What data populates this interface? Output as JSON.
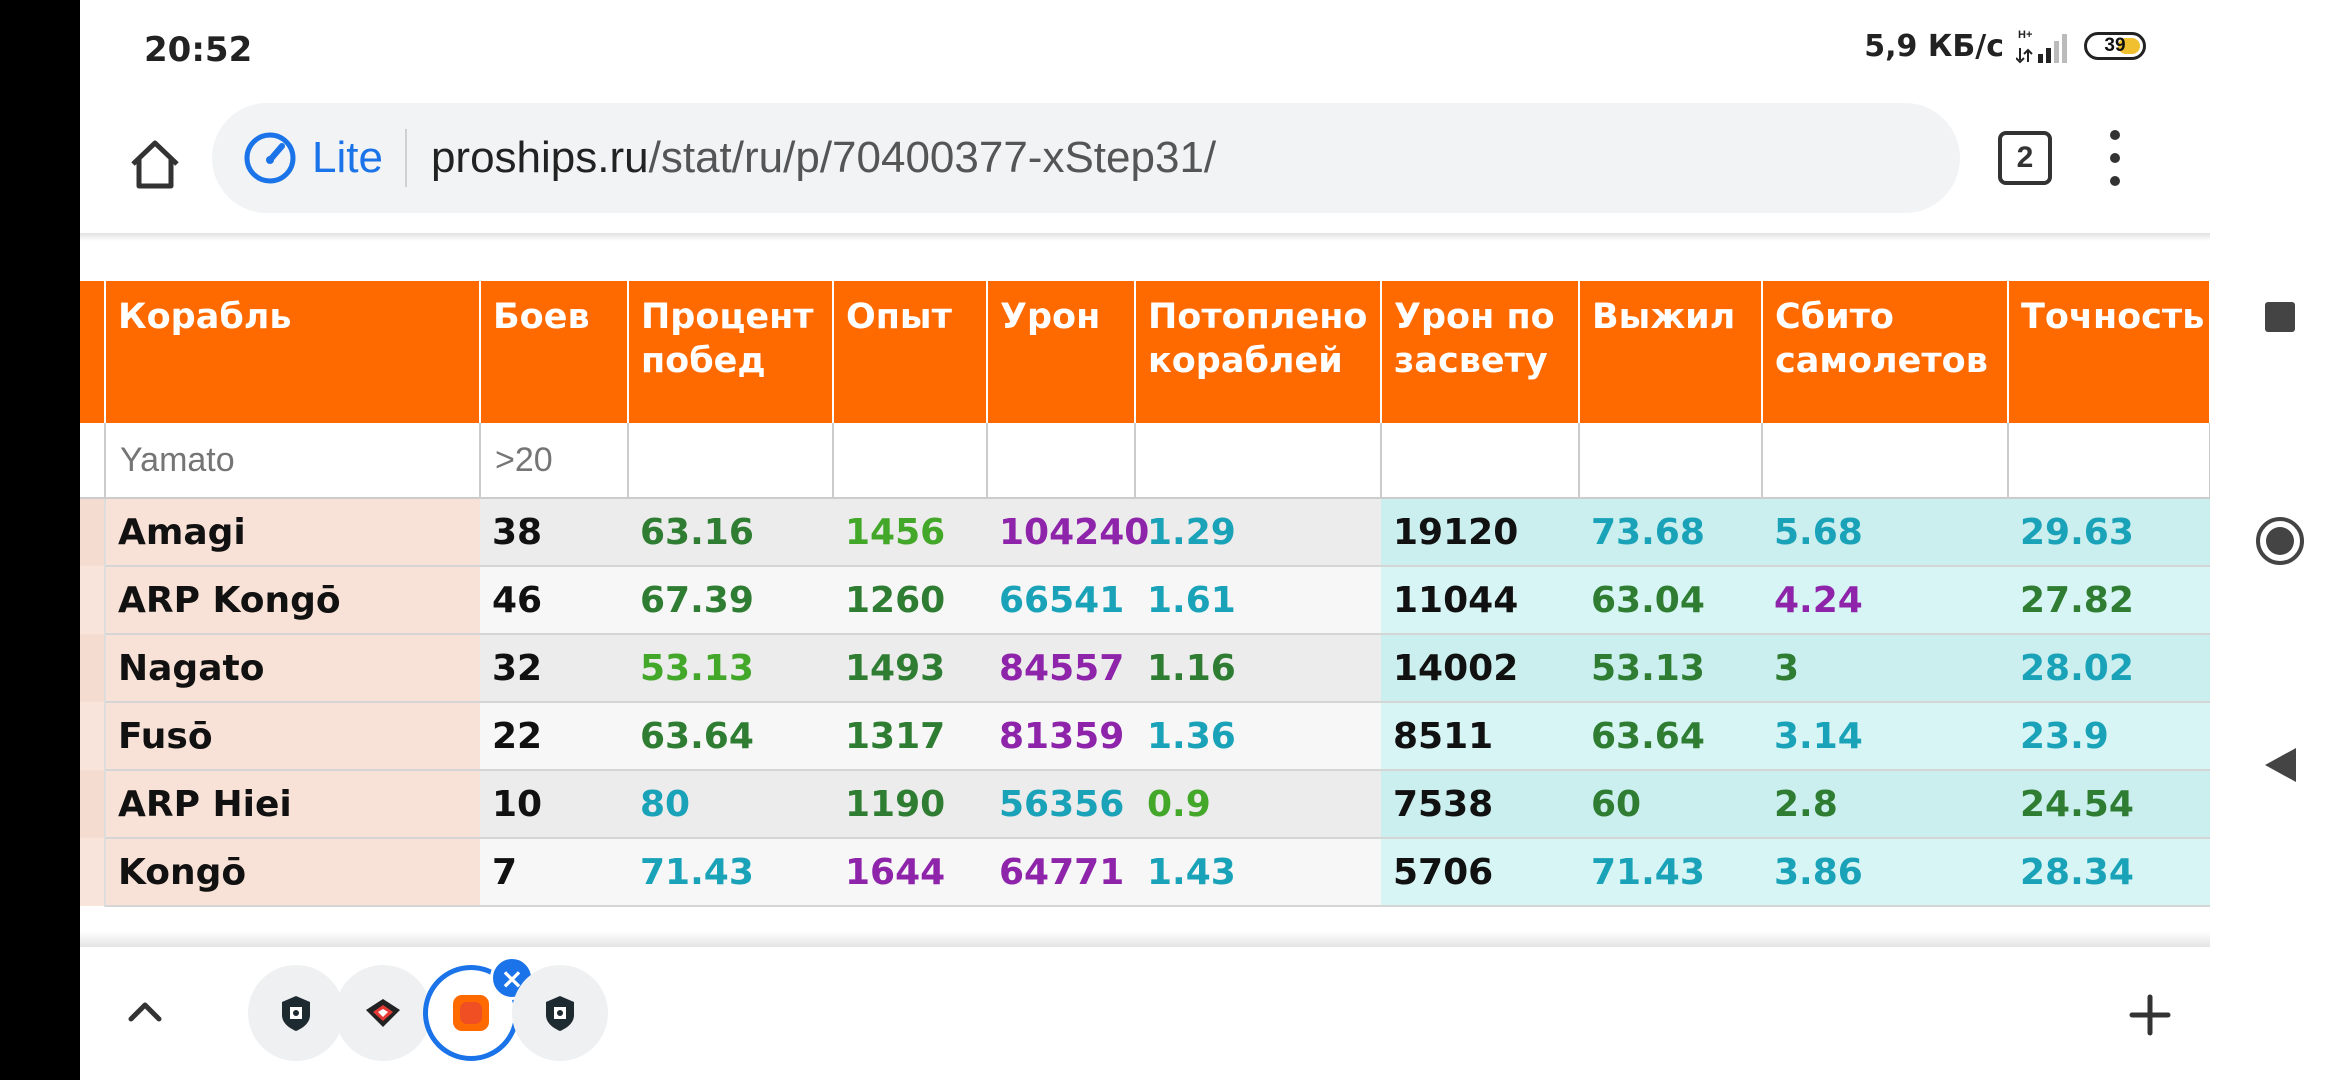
{
  "status_bar": {
    "time": "20:52",
    "net_speed": "5,9 КБ/с",
    "signal_label": "H+",
    "battery": "39"
  },
  "browser": {
    "lite_label": "Lite",
    "url_domain": "proships.ru",
    "url_path": "/stat/ru/p/70400377-xStep31/",
    "tab_count": "2"
  },
  "table": {
    "headers": [
      "Корабль",
      "Боев",
      "Процент побед",
      "Опыт",
      "Урон",
      "Потоплено кораблей",
      "Урон по засвету",
      "Выжил",
      "Сбито самолетов",
      "Точность"
    ],
    "filters": {
      "ship": "Yamato",
      "battles": ">20"
    },
    "rows": [
      [
        "Amagi",
        "38",
        "63.16",
        "1456",
        "104240",
        "1.29",
        "19120",
        "73.68",
        "5.68",
        "29.63"
      ],
      [
        "ARP Kongō",
        "46",
        "67.39",
        "1260",
        "66541",
        "1.61",
        "11044",
        "63.04",
        "4.24",
        "27.82"
      ],
      [
        "Nagato",
        "32",
        "53.13",
        "1493",
        "84557",
        "1.16",
        "14002",
        "53.13",
        "3",
        "28.02"
      ],
      [
        "Fusō",
        "22",
        "63.64",
        "1317",
        "81359",
        "1.36",
        "8511",
        "63.64",
        "3.14",
        "23.9"
      ],
      [
        "ARP Hiei",
        "10",
        "80",
        "1190",
        "56356",
        "0.9",
        "7538",
        "60",
        "2.8",
        "24.54"
      ],
      [
        "Kongō",
        "7",
        "71.43",
        "1644",
        "64771",
        "1.43",
        "5706",
        "71.43",
        "3.86",
        "28.34"
      ]
    ],
    "row_colors": [
      [
        "#111111",
        "#111111",
        "#2e7d32",
        "#43a82a",
        "#8e24aa",
        "#1aa3b8",
        "#111111",
        "#1aa3b8",
        "#1aa3b8",
        "#1aa3b8"
      ],
      [
        "#111111",
        "#111111",
        "#2e7d32",
        "#2e7d32",
        "#1aa3b8",
        "#1aa3b8",
        "#111111",
        "#2e7d32",
        "#8e24aa",
        "#2e7d32"
      ],
      [
        "#111111",
        "#111111",
        "#43a82a",
        "#2e7d32",
        "#8e24aa",
        "#2e7d32",
        "#111111",
        "#2e7d32",
        "#2e7d32",
        "#1aa3b8"
      ],
      [
        "#111111",
        "#111111",
        "#2e7d32",
        "#2e7d32",
        "#8e24aa",
        "#1aa3b8",
        "#111111",
        "#2e7d32",
        "#1aa3b8",
        "#1aa3b8"
      ],
      [
        "#111111",
        "#111111",
        "#1aa3b8",
        "#2e7d32",
        "#1aa3b8",
        "#43a82a",
        "#111111",
        "#2e7d32",
        "#2e7d32",
        "#2e7d32"
      ],
      [
        "#111111",
        "#111111",
        "#1aa3b8",
        "#8e24aa",
        "#8e24aa",
        "#1aa3b8",
        "#111111",
        "#1aa3b8",
        "#1aa3b8",
        "#1aa3b8"
      ]
    ]
  },
  "colors": {
    "header_bg": "#ff6a00",
    "accent": "#1a73e8"
  },
  "bottom_bar": {
    "tabs": [
      {
        "icon": "wows-logo-icon",
        "active": false
      },
      {
        "icon": "wows-emblem-icon",
        "active": false
      },
      {
        "icon": "proships-icon",
        "active": true
      },
      {
        "icon": "wows-logo-icon",
        "active": false
      }
    ]
  }
}
